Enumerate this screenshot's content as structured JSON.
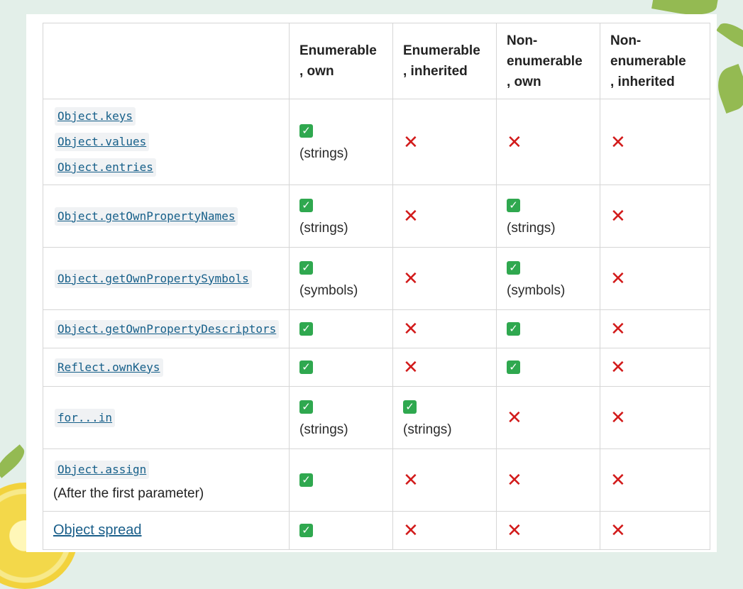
{
  "columns": [
    "",
    "Enumerable\n, own",
    "Enumerable\n, inherited",
    "Non-\nenumerable\n, own",
    "Non-\nenumerable\n, inherited"
  ],
  "rows": [
    {
      "methods": [
        "Object.keys",
        "Object.values",
        "Object.entries"
      ],
      "cells": [
        {
          "mark": "check",
          "note": "(strings)"
        },
        {
          "mark": "cross",
          "note": ""
        },
        {
          "mark": "cross",
          "note": ""
        },
        {
          "mark": "cross",
          "note": ""
        }
      ]
    },
    {
      "methods": [
        "Object.getOwnPropertyNames"
      ],
      "cells": [
        {
          "mark": "check",
          "note": "(strings)"
        },
        {
          "mark": "cross",
          "note": ""
        },
        {
          "mark": "check",
          "note": "(strings)"
        },
        {
          "mark": "cross",
          "note": ""
        }
      ]
    },
    {
      "methods": [
        "Object.getOwnPropertySymbols"
      ],
      "cells": [
        {
          "mark": "check",
          "note": "(symbols)"
        },
        {
          "mark": "cross",
          "note": ""
        },
        {
          "mark": "check",
          "note": "(symbols)"
        },
        {
          "mark": "cross",
          "note": ""
        }
      ]
    },
    {
      "methods": [
        "Object.getOwnPropertyDescriptors"
      ],
      "cells": [
        {
          "mark": "check",
          "note": ""
        },
        {
          "mark": "cross",
          "note": ""
        },
        {
          "mark": "check",
          "note": ""
        },
        {
          "mark": "cross",
          "note": ""
        }
      ]
    },
    {
      "methods": [
        "Reflect.ownKeys"
      ],
      "cells": [
        {
          "mark": "check",
          "note": ""
        },
        {
          "mark": "cross",
          "note": ""
        },
        {
          "mark": "check",
          "note": ""
        },
        {
          "mark": "cross",
          "note": ""
        }
      ]
    },
    {
      "methods": [
        "for...in"
      ],
      "cells": [
        {
          "mark": "check",
          "note": "(strings)"
        },
        {
          "mark": "check",
          "note": "(strings)"
        },
        {
          "mark": "cross",
          "note": ""
        },
        {
          "mark": "cross",
          "note": ""
        }
      ]
    },
    {
      "methods": [
        "Object.assign"
      ],
      "method_note": "(After the first parameter)",
      "cells": [
        {
          "mark": "check",
          "note": ""
        },
        {
          "mark": "cross",
          "note": ""
        },
        {
          "mark": "cross",
          "note": ""
        },
        {
          "mark": "cross",
          "note": ""
        }
      ]
    },
    {
      "link": "Object spread",
      "cells": [
        {
          "mark": "check",
          "note": ""
        },
        {
          "mark": "cross",
          "note": ""
        },
        {
          "mark": "cross",
          "note": ""
        },
        {
          "mark": "cross",
          "note": ""
        }
      ]
    }
  ],
  "icons": {
    "check": "white-check-mark-icon",
    "cross": "red-cross-icon"
  },
  "colors": {
    "check": "#2fa84f",
    "cross": "#d21a1a",
    "link": "#17608a"
  },
  "glyphs": {
    "check": "✓",
    "cross": "✕"
  }
}
